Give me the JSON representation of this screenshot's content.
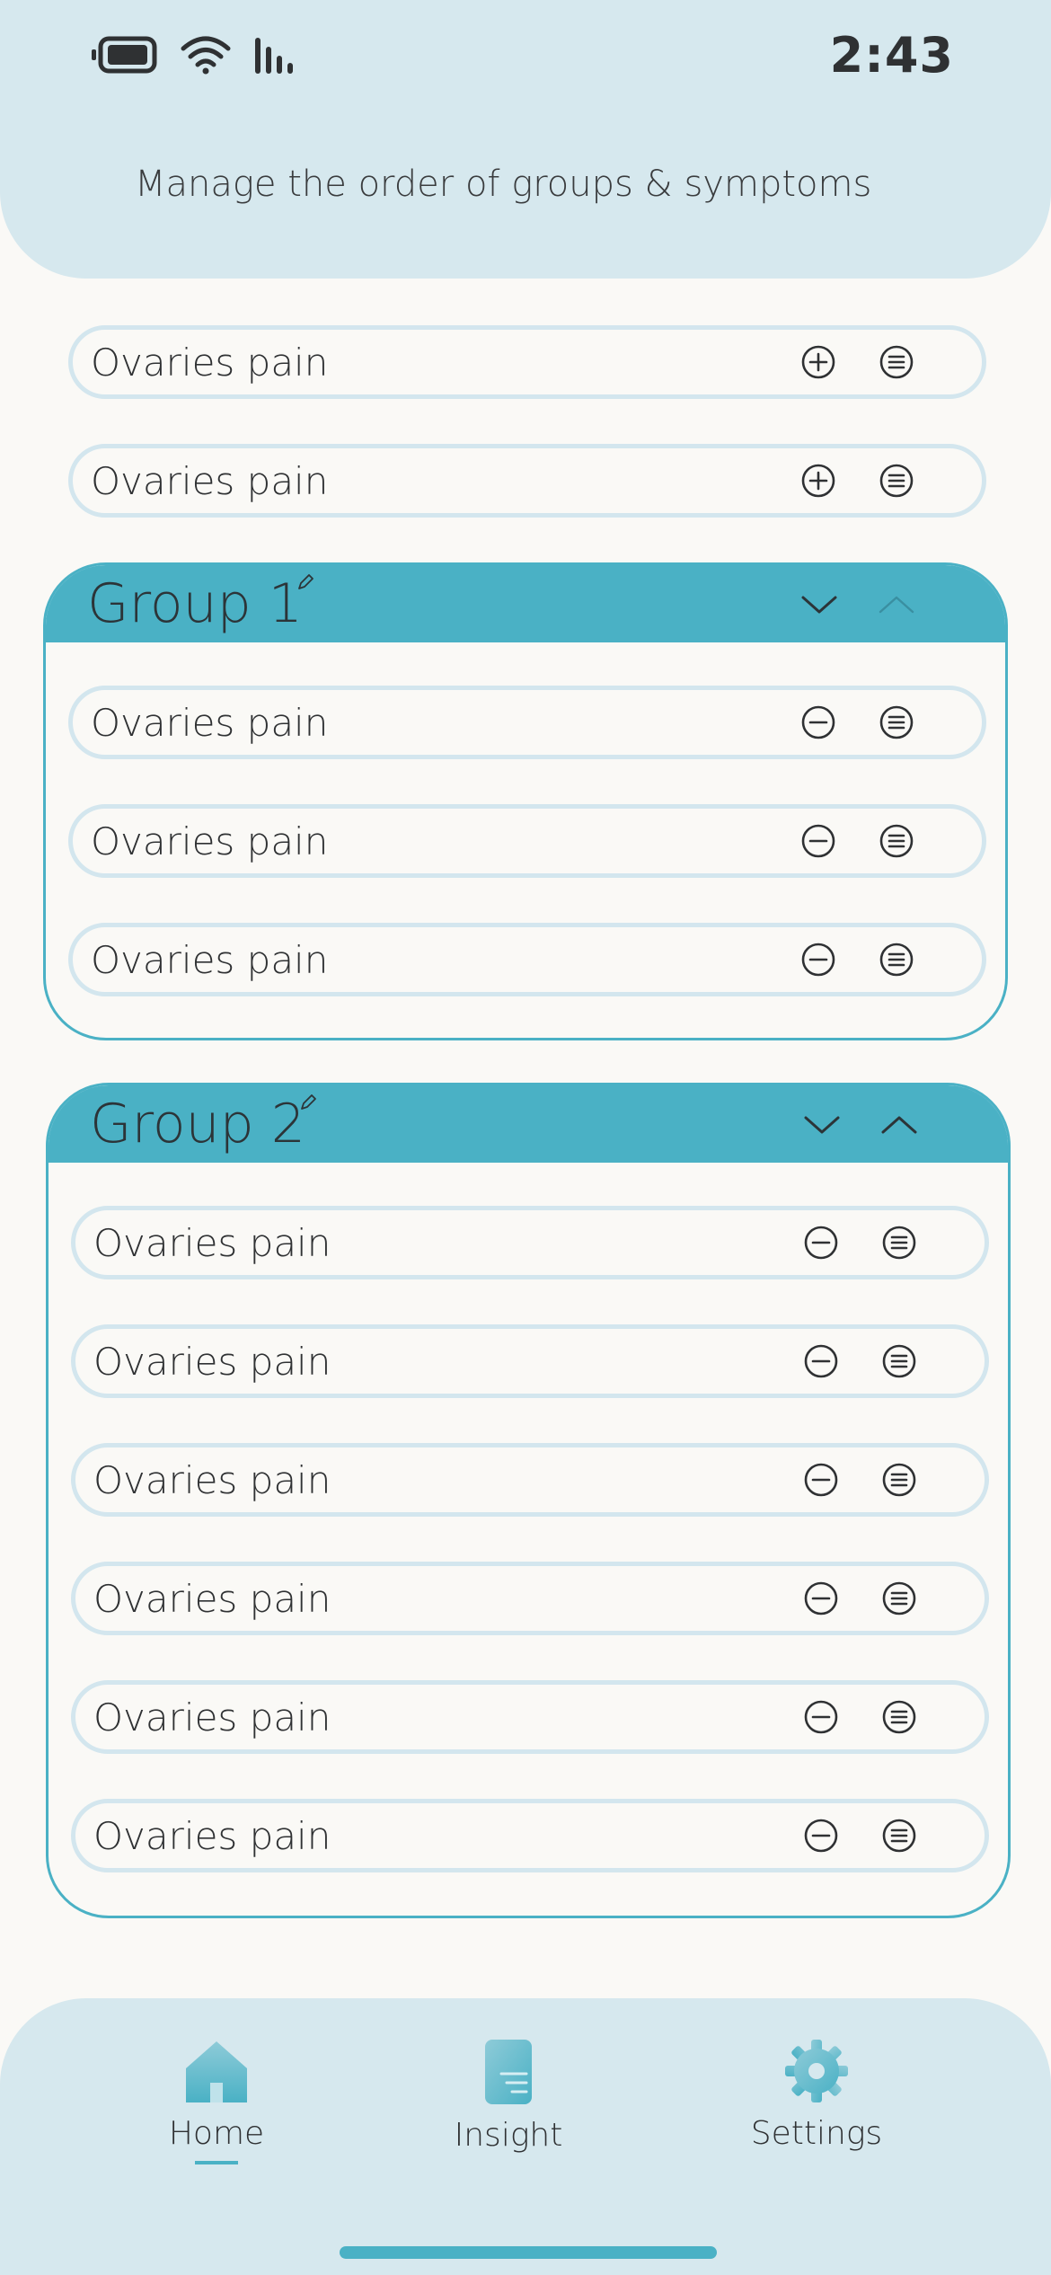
{
  "status_bar": {
    "time": "2:43",
    "icons": [
      "battery-icon",
      "wifi-icon",
      "signal-icon"
    ]
  },
  "header": {
    "title": "Manage the order of groups & symptoms"
  },
  "ungrouped": [
    {
      "label": "Ovaries pain",
      "action": "add-icon",
      "handle": "reorder-icon"
    },
    {
      "label": "Ovaries pain",
      "action": "add-icon",
      "handle": "reorder-icon"
    }
  ],
  "groups": [
    {
      "title": "Group 1",
      "edit_icon": "pencil-icon",
      "move_down_icon": "chevron-down-icon",
      "move_up_icon": "chevron-up-icon",
      "move_up_disabled": true,
      "items": [
        {
          "label": "Ovaries pain",
          "action": "remove-icon",
          "handle": "reorder-icon"
        },
        {
          "label": "Ovaries pain",
          "action": "remove-icon",
          "handle": "reorder-icon"
        },
        {
          "label": "Ovaries pain",
          "action": "remove-icon",
          "handle": "reorder-icon"
        }
      ]
    },
    {
      "title": "Group 2",
      "edit_icon": "pencil-icon",
      "move_down_icon": "chevron-down-icon",
      "move_up_icon": "chevron-up-icon",
      "move_up_disabled": false,
      "items": [
        {
          "label": "Ovaries pain",
          "action": "remove-icon",
          "handle": "reorder-icon"
        },
        {
          "label": "Ovaries pain",
          "action": "remove-icon",
          "handle": "reorder-icon"
        },
        {
          "label": "Ovaries pain",
          "action": "remove-icon",
          "handle": "reorder-icon"
        },
        {
          "label": "Ovaries pain",
          "action": "remove-icon",
          "handle": "reorder-icon"
        },
        {
          "label": "Ovaries pain",
          "action": "remove-icon",
          "handle": "reorder-icon"
        },
        {
          "label": "Ovaries pain",
          "action": "remove-icon",
          "handle": "reorder-icon"
        }
      ]
    }
  ],
  "bottom_nav": {
    "items": [
      {
        "label": "Home",
        "icon": "home-icon",
        "active": true
      },
      {
        "label": "Insight",
        "icon": "insight-icon",
        "active": false
      },
      {
        "label": "Settings",
        "icon": "gear-icon",
        "active": false
      }
    ]
  },
  "colors": {
    "accent": "#4AB1C5",
    "header_bg": "#D6E8EE",
    "page_bg": "#FAF9F6",
    "pill_border": "#D3E6EE",
    "text": "#2F3133"
  }
}
